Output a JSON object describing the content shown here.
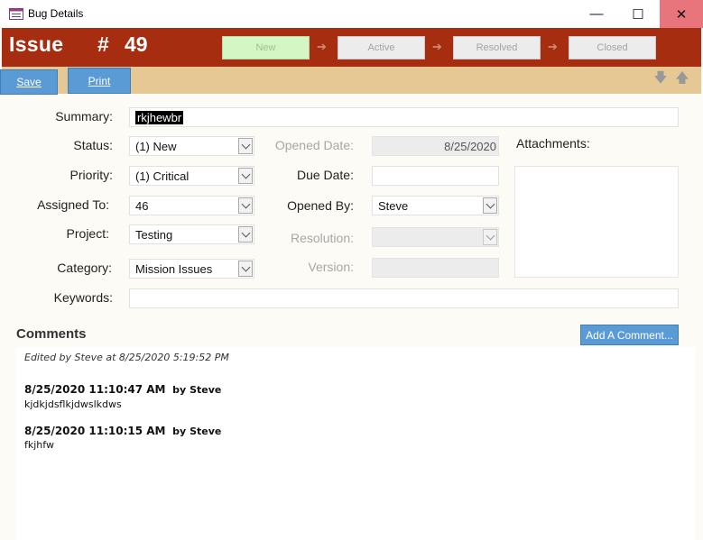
{
  "window": {
    "title": "Bug Details",
    "minimize_glyph": "—",
    "maximize_glyph": "☐",
    "close_glyph": "✕"
  },
  "header": {
    "title": "Issue",
    "hash": "#",
    "number": "49",
    "background_color": "#a62d10"
  },
  "stages": [
    {
      "label": "New",
      "active": true
    },
    {
      "label": "Active",
      "active": false
    },
    {
      "label": "Resolved",
      "active": false
    },
    {
      "label": "Closed",
      "active": false
    }
  ],
  "stage_arrow": "➔",
  "toolbar": {
    "save_label": "Save",
    "print_label": "Print",
    "down_arrow": "🡇",
    "up_arrow": "🡅"
  },
  "form": {
    "summary": {
      "label": "Summary:",
      "value": "rkjhewbr"
    },
    "status": {
      "label": "Status:",
      "value": "(1) New"
    },
    "priority": {
      "label": "Priority:",
      "value": "(1) Critical"
    },
    "assigned_to": {
      "label": "Assigned To:",
      "value": "46"
    },
    "project": {
      "label": "Project:",
      "value": "Testing"
    },
    "category": {
      "label": "Category:",
      "value": "Mission Issues"
    },
    "keywords": {
      "label": "Keywords:",
      "value": ""
    },
    "opened_date": {
      "label": "Opened Date:",
      "value": "8/25/2020"
    },
    "due_date": {
      "label": "Due Date:",
      "value": ""
    },
    "opened_by": {
      "label": "Opened By:",
      "value": "Steve"
    },
    "resolution": {
      "label": "Resolution:",
      "value": ""
    },
    "version": {
      "label": "Version:",
      "value": ""
    },
    "attachments": {
      "label": "Attachments:"
    }
  },
  "comments": {
    "title": "Comments",
    "add_label": "Add A Comment...",
    "edited_note": "Edited by Steve at 8/25/2020 5:19:52 PM",
    "items": [
      {
        "timestamp": "8/25/2020 11:10:47 AM",
        "by": "by",
        "author": "Steve",
        "text": "kjdkjdsflkjdwslkdws"
      },
      {
        "timestamp": "8/25/2020 11:10:15 AM",
        "by": "by",
        "author": "Steve",
        "text": "fkjhfw"
      }
    ]
  },
  "colors": {
    "accent_blue": "#5b9bd5",
    "toolbar_tan": "#e6c895",
    "close_red": "#e8747c",
    "stage_active_green": "#d4f5c4"
  }
}
